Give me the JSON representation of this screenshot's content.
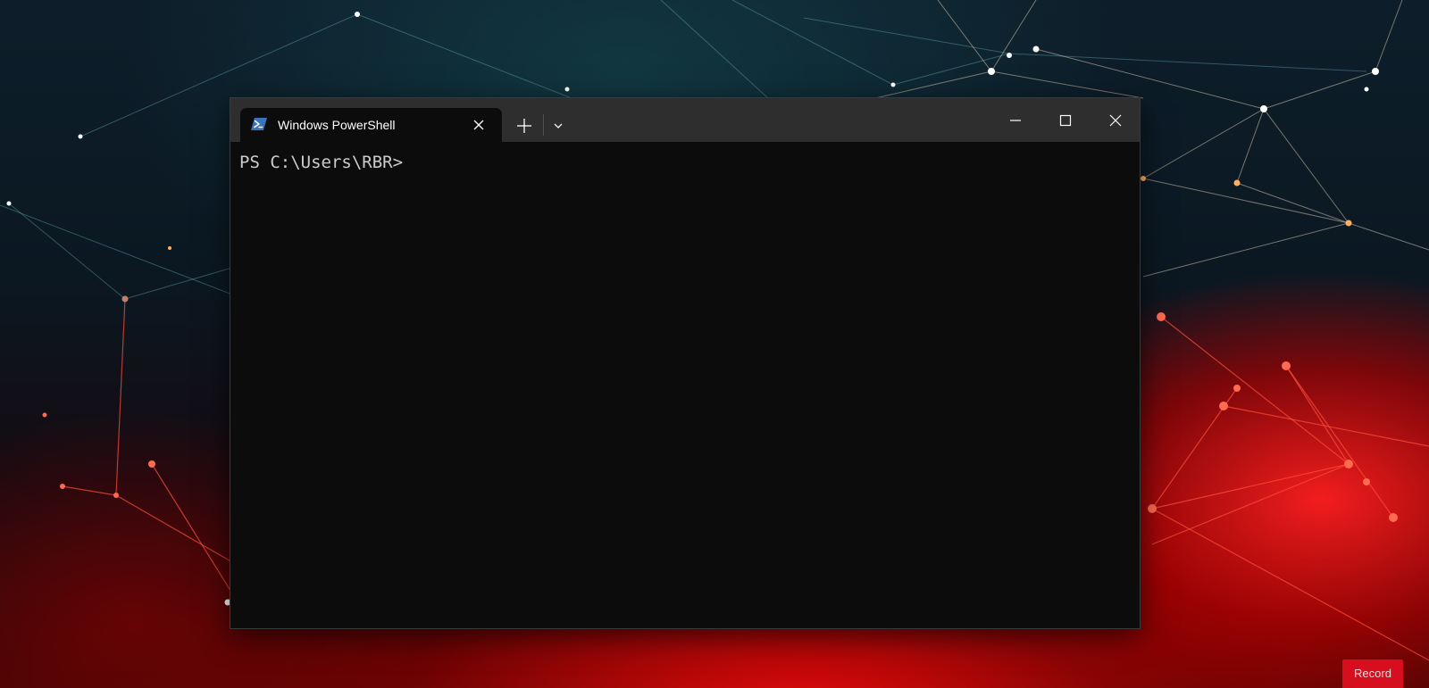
{
  "terminal": {
    "tab_title": "Windows PowerShell",
    "tab_icon": "powershell-icon",
    "new_tab_icon": "plus-icon",
    "dropdown_icon": "chevron-down-icon",
    "controls": {
      "minimize_icon": "minimize-icon",
      "maximize_icon": "maximize-icon",
      "close_icon": "close-icon"
    },
    "prompt": "PS C:\\Users\\RBR>"
  },
  "overlay": {
    "record_label": "Record"
  },
  "colors": {
    "titlebar": "#2e2e2e",
    "console_bg": "#0c0c0c",
    "console_text": "#cccccc",
    "powershell_blue": "#3b73b9"
  }
}
